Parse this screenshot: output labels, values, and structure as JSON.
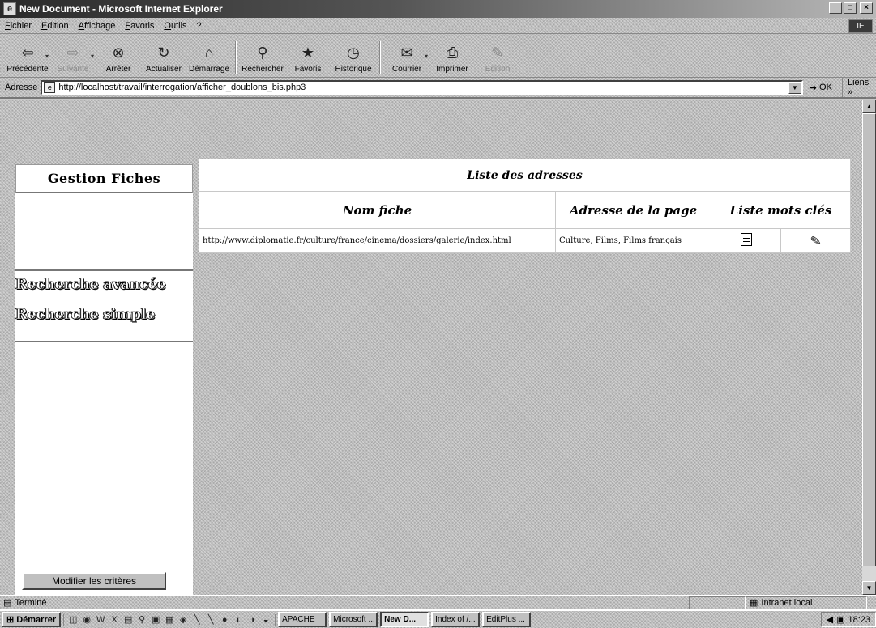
{
  "window": {
    "title": "New Document - Microsoft Internet Explorer",
    "minimize": "_",
    "maximize": "□",
    "close": "×",
    "throbber": "IE"
  },
  "menu": [
    "Fichier",
    "Edition",
    "Affichage",
    "Favoris",
    "Outils",
    "?"
  ],
  "toolbar": [
    {
      "name": "back",
      "label": "Précédente",
      "glyph": "⇦",
      "disabled": false,
      "dropdown": true
    },
    {
      "name": "forward",
      "label": "Suivante",
      "glyph": "⇨",
      "disabled": true,
      "dropdown": true
    },
    {
      "name": "stop",
      "label": "Arrêter",
      "glyph": "⊗",
      "disabled": false
    },
    {
      "name": "refresh",
      "label": "Actualiser",
      "glyph": "↻",
      "disabled": false
    },
    {
      "name": "home",
      "label": "Démarrage",
      "glyph": "⌂",
      "disabled": false
    },
    {
      "name": "search",
      "label": "Rechercher",
      "glyph": "⚲",
      "disabled": false
    },
    {
      "name": "favorites",
      "label": "Favoris",
      "glyph": "★",
      "disabled": false
    },
    {
      "name": "history",
      "label": "Historique",
      "glyph": "◷",
      "disabled": false
    },
    {
      "name": "mail",
      "label": "Courrier",
      "glyph": "✉",
      "disabled": false,
      "dropdown": true
    },
    {
      "name": "print",
      "label": "Imprimer",
      "glyph": "⎙",
      "disabled": false
    },
    {
      "name": "edit",
      "label": "Edition",
      "glyph": "✎",
      "disabled": true
    }
  ],
  "address": {
    "label": "Adresse",
    "url": "http://localhost/travail/interrogation/afficher_doublons_bis.php3",
    "go": "OK",
    "links": "Liens »"
  },
  "left_panel": {
    "title": "Gestion Fiches",
    "advanced_search": "Recherche avancée",
    "simple_search": "Recherche simple",
    "modify_button": "Modifier les critères"
  },
  "table": {
    "caption": "Liste des adresses",
    "headers": [
      "Nom fiche",
      "Adresse de la page",
      "Liste mots clés"
    ],
    "rows": [
      {
        "url": "http://www.diplomatie.fr/culture/france/cinema/dossiers/galerie/index.html",
        "keywords": "Culture, Films, Films français"
      }
    ]
  },
  "status": {
    "text": "Terminé",
    "zone": "Intranet local"
  },
  "taskbar": {
    "start": "Démarrer",
    "quick_launch": [
      "◫",
      "◉",
      "W",
      "X",
      "▤",
      "⚲",
      "▣",
      "▦",
      "◈",
      "╲",
      "╲",
      "●",
      "◐",
      "◑",
      "◒"
    ],
    "tasks": [
      {
        "label": "APACHE",
        "active": false
      },
      {
        "label": "Microsoft ...",
        "active": false
      },
      {
        "label": "New D...",
        "active": true
      },
      {
        "label": "Index of /...",
        "active": false
      },
      {
        "label": "EditPlus ...",
        "active": false
      }
    ],
    "clock": "18:23"
  }
}
